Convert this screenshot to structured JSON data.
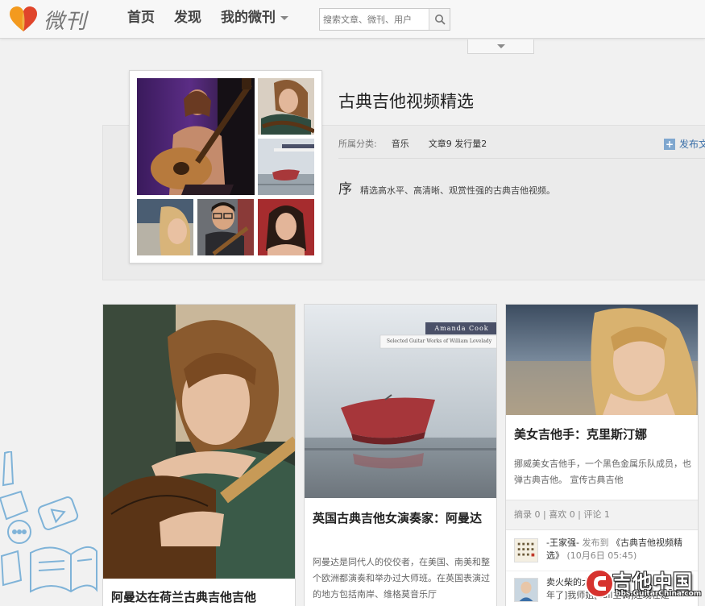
{
  "brand": {
    "name": "微刊"
  },
  "nav": {
    "items": [
      {
        "label": "首页"
      },
      {
        "label": "发现"
      },
      {
        "label": "我的微刊"
      }
    ]
  },
  "search": {
    "placeholder": "搜索文章、微刊、用户"
  },
  "magazine": {
    "title": "古典吉他视频精选",
    "category_label": "所属分类:",
    "category_value": "音乐",
    "stats": "文章9 发行量2",
    "publish_label": "发布文",
    "intro_label": "序",
    "intro_text": "精选高水平、高清晰、观赏性强的古典吉他视频。"
  },
  "cards": [
    {
      "title": "阿曼达在荷兰古典吉他吉他"
    },
    {
      "image_caption_name": "Amanda Cook",
      "image_caption_sub": "Selected Guitar Works of William Lovelady",
      "title": "英国古典吉他女演奏家：阿曼达",
      "body": "阿曼达是同代人的佼佼者，在美国、南美和整个欧洲都演奏和举办过大师班。在英国表演过的地方包括南岸、维格莫音乐厅"
    },
    {
      "title": "美女吉他手：克里斯汀娜",
      "body": "挪威美女吉他手，一个黑色金属乐队成员，也弹古典吉他。 宣传古典吉他",
      "stats": "摘录 0 | 喜欢 0 | 评论 1",
      "feed": [
        {
          "user": "-王家强-",
          "verb": "发布到",
          "link": "《古典吉他视频精选》",
          "date": "(10月6日 05:45)"
        },
        {
          "user": "卖火柴的大",
          "text": "年了]我师姐[call主调]还现在是",
          "suffix": "有"
        }
      ]
    }
  ],
  "watermark": {
    "main": "吉他中国",
    "url": "bbs.GuitarChina.com"
  },
  "colors": {
    "accent_link": "#3a6fa8",
    "logo_orange": "#f39a1e",
    "logo_red": "#e0452b"
  }
}
